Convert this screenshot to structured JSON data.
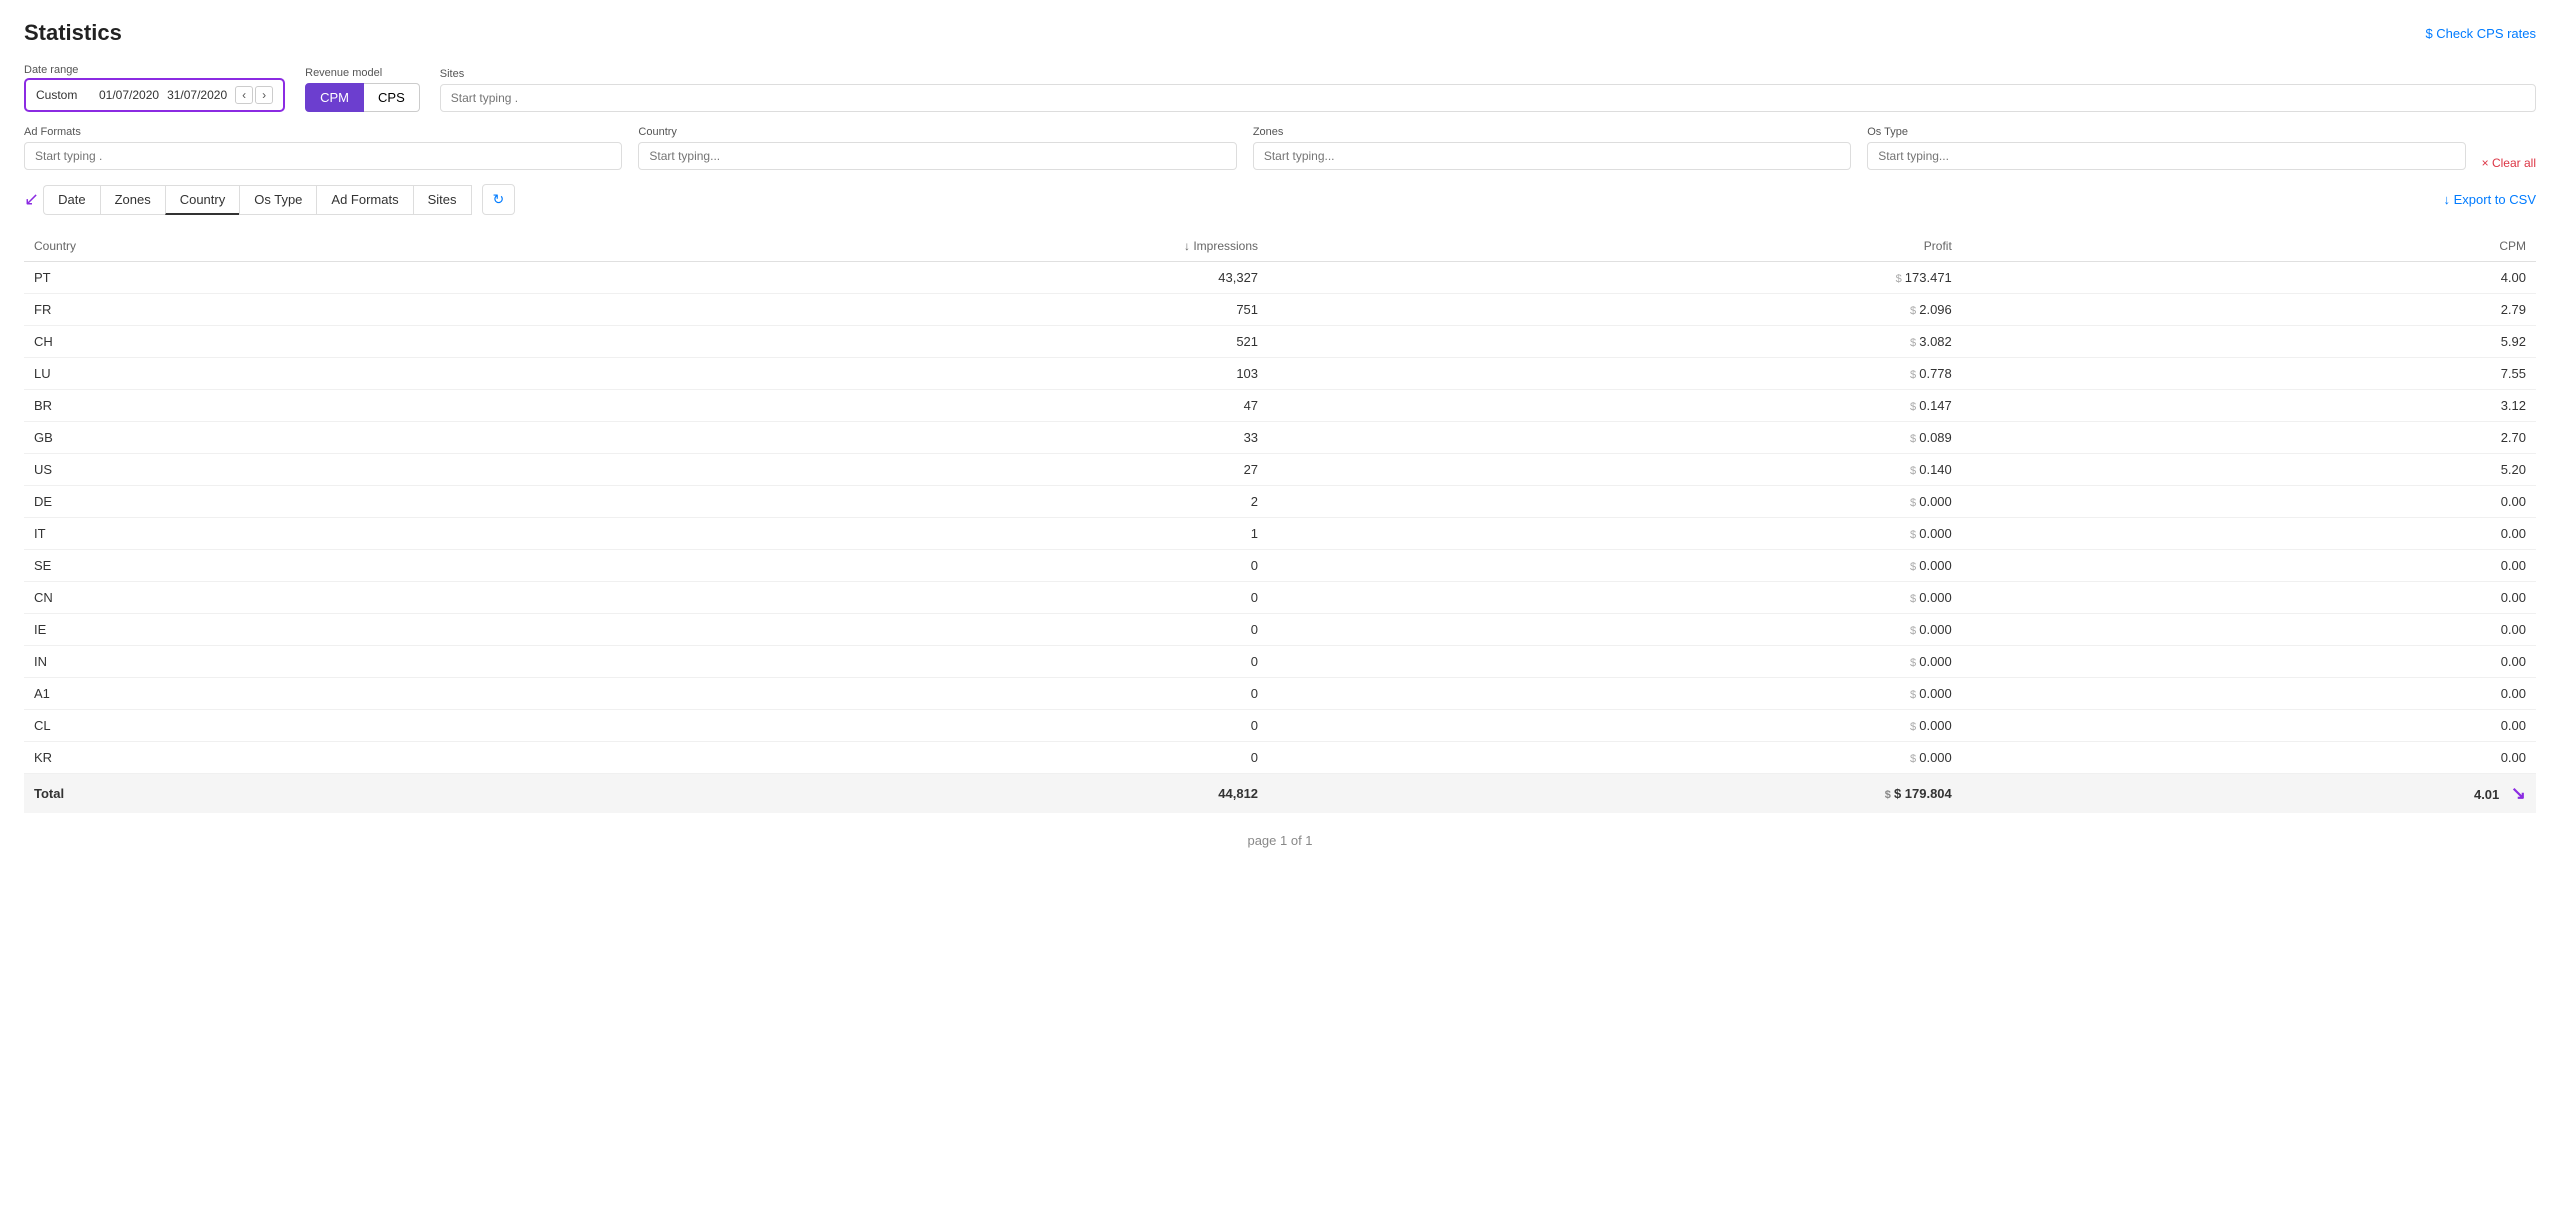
{
  "page": {
    "title": "Statistics",
    "check_cps_label": "$ Check CPS rates"
  },
  "filters": {
    "date_range": {
      "label": "Date range",
      "preset": "Custom",
      "start_date": "01/07/2020",
      "end_date": "31/07/2020"
    },
    "revenue_model": {
      "label": "Revenue model",
      "options": [
        "CPM",
        "CPS"
      ],
      "active": "CPM"
    },
    "sites": {
      "label": "Sites",
      "placeholder": "Start typing ."
    },
    "ad_formats": {
      "label": "Ad Formats",
      "placeholder": "Start typing ."
    },
    "country": {
      "label": "Country",
      "placeholder": "Start typing..."
    },
    "zones": {
      "label": "Zones",
      "placeholder": "Start typing..."
    },
    "os_type": {
      "label": "Os Type",
      "placeholder": "Start typing..."
    },
    "clear_all": "× Clear all"
  },
  "tabs": {
    "items": [
      {
        "label": "Date",
        "active": false
      },
      {
        "label": "Zones",
        "active": false
      },
      {
        "label": "Country",
        "active": true
      },
      {
        "label": "Os Type",
        "active": false
      },
      {
        "label": "Ad Formats",
        "active": false
      },
      {
        "label": "Sites",
        "active": false
      }
    ]
  },
  "export_label": "↓ Export to CSV",
  "table": {
    "columns": [
      {
        "key": "country",
        "label": "Country",
        "align": "left"
      },
      {
        "key": "impressions",
        "label": "↓ Impressions",
        "align": "right"
      },
      {
        "key": "profit",
        "label": "Profit",
        "align": "right"
      },
      {
        "key": "cpm",
        "label": "CPM",
        "align": "right"
      }
    ],
    "rows": [
      {
        "country": "PT",
        "impressions": "43,327",
        "profit": "$ 173.471",
        "cpm": "4.00"
      },
      {
        "country": "FR",
        "impressions": "751",
        "profit": "$ 2.096",
        "cpm": "2.79"
      },
      {
        "country": "CH",
        "impressions": "521",
        "profit": "$ 3.082",
        "cpm": "5.92"
      },
      {
        "country": "LU",
        "impressions": "103",
        "profit": "$ 0.778",
        "cpm": "7.55"
      },
      {
        "country": "BR",
        "impressions": "47",
        "profit": "$ 0.147",
        "cpm": "3.12"
      },
      {
        "country": "GB",
        "impressions": "33",
        "profit": "$ 0.089",
        "cpm": "2.70"
      },
      {
        "country": "US",
        "impressions": "27",
        "profit": "$ 0.140",
        "cpm": "5.20"
      },
      {
        "country": "DE",
        "impressions": "2",
        "profit": "$ 0.000",
        "cpm": "0.00"
      },
      {
        "country": "IT",
        "impressions": "1",
        "profit": "$ 0.000",
        "cpm": "0.00"
      },
      {
        "country": "SE",
        "impressions": "0",
        "profit": "$ 0.000",
        "cpm": "0.00"
      },
      {
        "country": "CN",
        "impressions": "0",
        "profit": "$ 0.000",
        "cpm": "0.00"
      },
      {
        "country": "IE",
        "impressions": "0",
        "profit": "$ 0.000",
        "cpm": "0.00"
      },
      {
        "country": "IN",
        "impressions": "0",
        "profit": "$ 0.000",
        "cpm": "0.00"
      },
      {
        "country": "A1",
        "impressions": "0",
        "profit": "$ 0.000",
        "cpm": "0.00"
      },
      {
        "country": "CL",
        "impressions": "0",
        "profit": "$ 0.000",
        "cpm": "0.00"
      },
      {
        "country": "KR",
        "impressions": "0",
        "profit": "$ 0.000",
        "cpm": "0.00"
      }
    ],
    "total": {
      "label": "Total",
      "impressions": "44,812",
      "profit": "$ 179.804",
      "cpm": "4.01"
    }
  },
  "pagination": {
    "label": "page 1 of 1"
  }
}
